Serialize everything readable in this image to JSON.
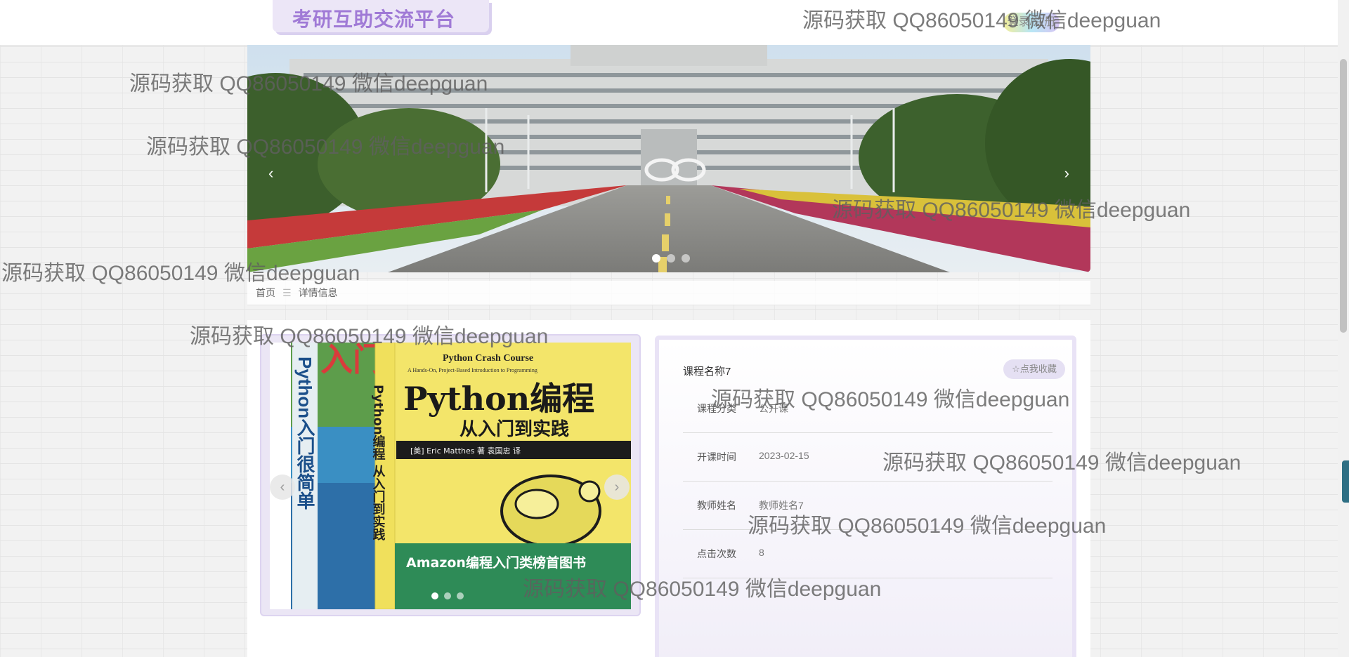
{
  "header": {
    "logo_text": "考研互助交流平台",
    "login_label": "登录/注册"
  },
  "banner": {
    "prev_label": "‹",
    "next_label": "›",
    "slide_count": 3,
    "active_slide": 1
  },
  "breadcrumb": {
    "home": "首页",
    "separator": "☰",
    "current": "详情信息"
  },
  "detail": {
    "course_name": "课程名称7",
    "favorite_label": "☆点我收藏",
    "rows": [
      {
        "label": "课程分类",
        "value": "公开课"
      },
      {
        "label": "开课时间",
        "value": "2023-02-15"
      },
      {
        "label": "教师姓名",
        "value": "教师姓名7"
      },
      {
        "label": "点击次数",
        "value": "8"
      }
    ]
  },
  "book_cover": {
    "series_title": "Python Crash Course",
    "subtitle": "A Hands-On, Project-Based Introduction to Programming",
    "title": "Python编程",
    "subtitle_cn": "从入门到实践",
    "author": "[美] Eric Matthes 著 袁国忠 译",
    "badge": "Amazon编程入门类榜首图书",
    "spine_text": "Python编程 从入门到实践",
    "left_book_spine": "Python入门很简单",
    "left_book_big": "入门",
    "prev_label": "‹",
    "next_label": "›"
  },
  "watermark": "源码获取 QQ86050149 微信deepguan",
  "colors": {
    "logo_text": "#a07ad6",
    "logo_bg": "#ece6f7",
    "card_border": "#e9e3f6",
    "book_yellow": "#f3e56a",
    "book_green": "#2e8b57"
  }
}
